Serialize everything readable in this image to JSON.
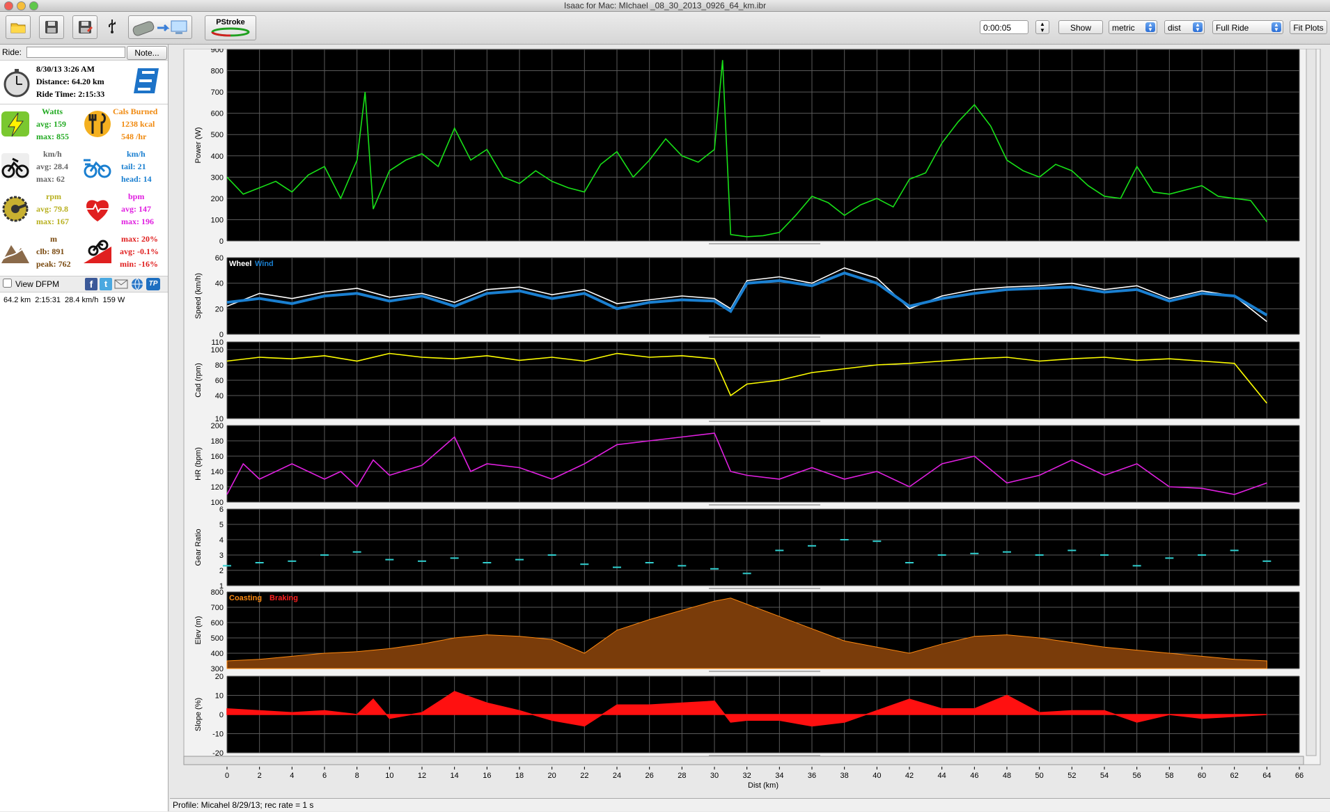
{
  "window": {
    "title": "Isaac for Mac:  MIchael _08_30_2013_0926_64_km.ibr"
  },
  "toolbar": {
    "pstroke_label": "PStroke",
    "time_value": "0:00:05",
    "show_label": "Show",
    "units_select": "metric",
    "xaxis_select": "dist",
    "range_select": "Full Ride",
    "fit_label": "Fit Plots"
  },
  "sidebar": {
    "ride_label": "Ride:",
    "ride_value": "",
    "note_label": "Note...",
    "date": "8/30/13 3:26 AM",
    "distance": "Distance: 64.20 km",
    "ride_time": "Ride Time: 2:15:33",
    "watts": {
      "title": "Watts",
      "avg": "avg: 159",
      "max": "max: 855"
    },
    "cals": {
      "title": "Cals Burned",
      "total": "1238 kcal",
      "rate": "548 /hr"
    },
    "speed": {
      "title": "km/h",
      "avg": "avg: 28.4",
      "max": "max: 62"
    },
    "wind": {
      "title": "km/h",
      "tail": "tail: 21",
      "head": "head: 14"
    },
    "cadence": {
      "title": "rpm",
      "avg": "avg: 79.8",
      "max": "max: 167"
    },
    "heart": {
      "title": "bpm",
      "avg": "avg: 147",
      "max": "max: 196"
    },
    "climb": {
      "title": "m",
      "clb": "clb: 891",
      "peak": "peak: 762"
    },
    "grade": {
      "max": "max: 20%",
      "avg": "avg: -0.1%",
      "min": "min: -16%"
    },
    "dfpm_label": "View DFPM",
    "summary": "64.2 km  2:15:31  28.4 km/h  159 W"
  },
  "status": {
    "profile": "Profile: Micahel 8/29/13; rec rate = 1 s"
  },
  "colors": {
    "power": "#18e018",
    "wheel": "#ffffff",
    "wind": "#1a7fd0",
    "cadence": "#ffff00",
    "hr": "#e020e0",
    "gear": "#30d0d0",
    "coast": "#ff8a10",
    "brake": "#ff2020",
    "elev": "#7a3c0a",
    "slope": "#ff1010"
  },
  "chart_data": {
    "type": "line",
    "x_label": "Dist (km)",
    "x_ticks": [
      "0",
      "2",
      "4",
      "6",
      "8",
      "10",
      "12",
      "14",
      "16",
      "18",
      "20",
      "22",
      "24",
      "26",
      "28",
      "30",
      "32",
      "34",
      "36",
      "38",
      "40",
      "42",
      "44",
      "46",
      "48",
      "50",
      "52",
      "54",
      "56",
      "58",
      "60",
      "62",
      "64",
      "66"
    ],
    "xlim": [
      0,
      66
    ],
    "panels": [
      {
        "id": "power",
        "ylabel": "Power (W)",
        "ylim": [
          0,
          900
        ],
        "yticks": [
          "0",
          "100",
          "200",
          "300",
          "400",
          "500",
          "600",
          "700",
          "800",
          "900"
        ],
        "legend": [],
        "series": [
          {
            "name": "",
            "x": [
              0,
              1,
              2,
              3,
              4,
              5,
              6,
              7,
              8,
              8.5,
              9,
              10,
              11,
              12,
              13,
              14,
              15,
              16,
              17,
              18,
              19,
              20,
              21,
              22,
              23,
              24,
              25,
              26,
              27,
              28,
              29,
              30,
              30.5,
              31,
              32,
              33,
              34,
              35,
              36,
              37,
              38,
              39,
              40,
              41,
              42,
              43,
              44,
              45,
              46,
              47,
              48,
              49,
              50,
              51,
              52,
              53,
              54,
              55,
              56,
              57,
              58,
              59,
              60,
              61,
              62,
              63,
              64
            ],
            "y": [
              300,
              220,
              250,
              280,
              230,
              310,
              350,
              200,
              380,
              700,
              150,
              330,
              380,
              410,
              350,
              530,
              380,
              430,
              300,
              270,
              330,
              280,
              250,
              230,
              360,
              420,
              300,
              380,
              480,
              400,
              370,
              430,
              850,
              30,
              20,
              25,
              40,
              120,
              210,
              180,
              120,
              170,
              200,
              160,
              290,
              320,
              460,
              560,
              640,
              540,
              380,
              330,
              300,
              360,
              330,
              260,
              210,
              200,
              350,
              230,
              220,
              240,
              260,
              210,
              200,
              190,
              90
            ]
          }
        ]
      },
      {
        "id": "speed",
        "ylabel": "Speed (km/h)",
        "ylim": [
          0,
          60
        ],
        "yticks": [
          "0",
          "20",
          "40",
          "60"
        ],
        "legend": [
          "Wheel",
          "Wind"
        ],
        "series": [
          {
            "name": "Wheel",
            "x": [
              0,
              2,
              4,
              6,
              8,
              10,
              12,
              14,
              16,
              18,
              20,
              22,
              24,
              26,
              28,
              30,
              31,
              32,
              34,
              36,
              38,
              40,
              42,
              44,
              46,
              48,
              50,
              52,
              54,
              56,
              58,
              60,
              62,
              64
            ],
            "y": [
              22,
              32,
              28,
              33,
              36,
              29,
              32,
              25,
              35,
              37,
              31,
              35,
              24,
              27,
              30,
              28,
              20,
              42,
              45,
              40,
              52,
              44,
              20,
              30,
              35,
              37,
              38,
              40,
              35,
              38,
              28,
              34,
              30,
              10
            ]
          },
          {
            "name": "Wind",
            "x": [
              0,
              2,
              4,
              6,
              8,
              10,
              12,
              14,
              16,
              18,
              20,
              22,
              24,
              26,
              28,
              30,
              31,
              32,
              34,
              36,
              38,
              40,
              42,
              44,
              46,
              48,
              50,
              52,
              54,
              56,
              58,
              60,
              62,
              64
            ],
            "y": [
              25,
              28,
              24,
              30,
              32,
              26,
              30,
              22,
              32,
              34,
              28,
              32,
              20,
              25,
              27,
              26,
              18,
              40,
              42,
              38,
              48,
              40,
              22,
              28,
              32,
              35,
              36,
              37,
              33,
              35,
              26,
              32,
              30,
              15
            ]
          }
        ]
      },
      {
        "id": "cadence",
        "ylabel": "Cad (rpm)",
        "ylim": [
          10,
          110
        ],
        "yticks": [
          "10",
          "40",
          "60",
          "80",
          "100",
          "110"
        ],
        "legend": [],
        "series": [
          {
            "name": "",
            "x": [
              0,
              2,
              4,
              6,
              8,
              10,
              12,
              14,
              16,
              18,
              20,
              22,
              24,
              26,
              28,
              30,
              31,
              32,
              34,
              36,
              38,
              40,
              42,
              44,
              46,
              48,
              50,
              52,
              54,
              56,
              58,
              60,
              62,
              64
            ],
            "y": [
              85,
              90,
              88,
              92,
              85,
              95,
              90,
              88,
              92,
              86,
              90,
              85,
              95,
              90,
              92,
              88,
              40,
              55,
              60,
              70,
              75,
              80,
              82,
              85,
              88,
              90,
              85,
              88,
              90,
              86,
              88,
              85,
              82,
              30
            ]
          }
        ]
      },
      {
        "id": "hr",
        "ylabel": "HR (bpm)",
        "ylim": [
          100,
          200
        ],
        "yticks": [
          "100",
          "120",
          "140",
          "160",
          "180",
          "200"
        ],
        "legend": [],
        "series": [
          {
            "name": "",
            "x": [
              0,
              1,
              2,
              4,
              6,
              7,
              8,
              9,
              10,
              12,
              14,
              15,
              16,
              18,
              20,
              22,
              24,
              26,
              28,
              30,
              31,
              32,
              34,
              36,
              38,
              40,
              42,
              44,
              46,
              48,
              50,
              52,
              54,
              56,
              58,
              60,
              62,
              64
            ],
            "y": [
              110,
              150,
              130,
              150,
              130,
              140,
              120,
              155,
              135,
              148,
              185,
              140,
              150,
              145,
              130,
              150,
              175,
              180,
              185,
              190,
              140,
              135,
              130,
              145,
              130,
              140,
              120,
              150,
              160,
              125,
              135,
              155,
              135,
              150,
              120,
              118,
              110,
              125
            ]
          }
        ]
      },
      {
        "id": "gear",
        "ylabel": "Gear Ratio",
        "ylim": [
          1,
          6
        ],
        "yticks": [
          "1",
          "2",
          "3",
          "4",
          "5",
          "6"
        ],
        "legend": [],
        "series": [
          {
            "name": "",
            "x": [
              0,
              2,
              4,
              6,
              8,
              10,
              12,
              14,
              16,
              18,
              20,
              22,
              24,
              26,
              28,
              30,
              32,
              34,
              36,
              38,
              40,
              42,
              44,
              46,
              48,
              50,
              52,
              54,
              56,
              58,
              60,
              62,
              64
            ],
            "y": [
              2.3,
              2.5,
              2.6,
              3.0,
              3.2,
              2.7,
              2.6,
              2.8,
              2.5,
              2.7,
              3.0,
              2.4,
              2.2,
              2.5,
              2.3,
              2.1,
              1.8,
              3.3,
              3.6,
              4.0,
              3.9,
              2.5,
              3.0,
              3.1,
              3.2,
              3.0,
              3.3,
              3.0,
              2.3,
              2.8,
              3.0,
              3.3,
              2.6
            ]
          }
        ]
      },
      {
        "id": "elev",
        "ylabel": "Elev (m)",
        "ylim": [
          300,
          800
        ],
        "yticks": [
          "300",
          "400",
          "500",
          "600",
          "700",
          "800"
        ],
        "legend": [
          "Coasting",
          "Braking"
        ],
        "series": [
          {
            "name": "",
            "x": [
              0,
              2,
              4,
              6,
              8,
              10,
              12,
              14,
              16,
              18,
              20,
              22,
              24,
              26,
              28,
              30,
              31,
              32,
              34,
              36,
              38,
              40,
              42,
              44,
              46,
              48,
              50,
              52,
              54,
              56,
              58,
              60,
              62,
              64
            ],
            "y": [
              350,
              360,
              380,
              400,
              410,
              430,
              460,
              500,
              520,
              510,
              490,
              400,
              550,
              620,
              680,
              740,
              760,
              720,
              640,
              560,
              480,
              440,
              400,
              460,
              510,
              520,
              500,
              470,
              440,
              420,
              400,
              380,
              360,
              350
            ]
          }
        ]
      },
      {
        "id": "slope",
        "ylabel": "Slope (%)",
        "ylim": [
          -20,
          20
        ],
        "yticks": [
          "-20",
          "-10",
          "0",
          "10",
          "20"
        ],
        "legend": [],
        "series": [
          {
            "name": "",
            "x": [
              0,
              2,
              4,
              6,
              8,
              9,
              10,
              12,
              14,
              16,
              18,
              20,
              22,
              24,
              26,
              28,
              30,
              31,
              32,
              34,
              36,
              38,
              40,
              42,
              44,
              46,
              48,
              50,
              52,
              54,
              56,
              58,
              60,
              62,
              64
            ],
            "y": [
              3,
              2,
              1,
              2,
              0,
              8,
              -2,
              1,
              12,
              6,
              2,
              -3,
              -6,
              5,
              5,
              6,
              7,
              -4,
              -3,
              -3,
              -6,
              -4,
              2,
              8,
              3,
              3,
              10,
              1,
              2,
              2,
              -4,
              0,
              -2,
              -1,
              0
            ]
          }
        ]
      }
    ]
  }
}
